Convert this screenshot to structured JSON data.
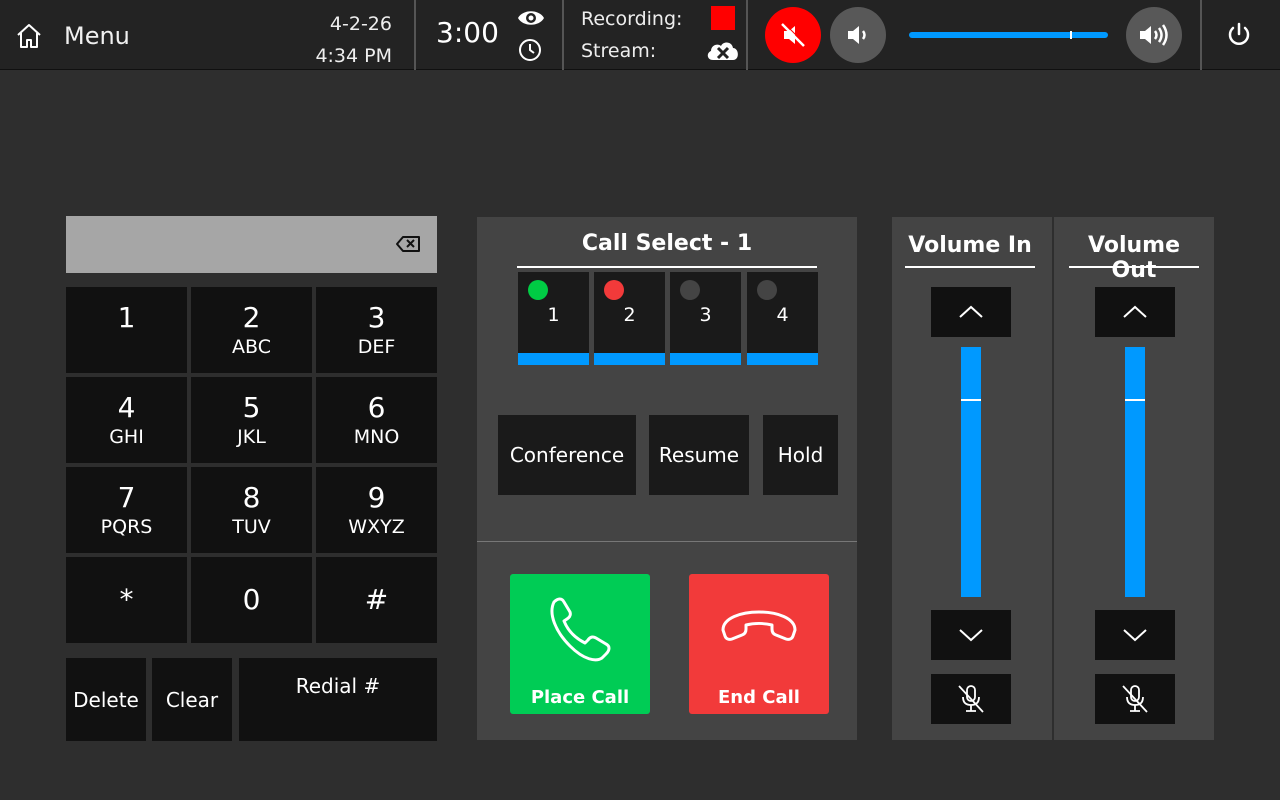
{
  "header": {
    "menu_label": "Menu",
    "date": "4-2-26",
    "time": "4:34 PM",
    "timer": "3:00",
    "recording_label": "Recording:",
    "stream_label": "Stream:",
    "recording_status_color": "#ff0000",
    "master_volume_fraction": 0.81,
    "icons": [
      "home-icon",
      "eye-icon",
      "clock-icon",
      "cloud-off-icon",
      "speaker-mute-icon",
      "volume-down-icon",
      "volume-up-icon",
      "power-icon"
    ]
  },
  "keypad": {
    "dial_value": "",
    "keys": [
      {
        "num": "1",
        "letters": ""
      },
      {
        "num": "2",
        "letters": "ABC"
      },
      {
        "num": "3",
        "letters": "DEF"
      },
      {
        "num": "4",
        "letters": "GHI"
      },
      {
        "num": "5",
        "letters": "JKL"
      },
      {
        "num": "6",
        "letters": "MNO"
      },
      {
        "num": "7",
        "letters": "PQRS"
      },
      {
        "num": "8",
        "letters": "TUV"
      },
      {
        "num": "9",
        "letters": "WXYZ"
      },
      {
        "num": "*",
        "letters": ""
      },
      {
        "num": "0",
        "letters": ""
      },
      {
        "num": "#",
        "letters": ""
      }
    ],
    "delete_label": "Delete",
    "clear_label": "Clear",
    "redial_label": "Redial #"
  },
  "call_select": {
    "title": "Call Select - 1",
    "lines": [
      {
        "num": "1",
        "status_color": "#00cc44"
      },
      {
        "num": "2",
        "status_color": "#f23a3a"
      },
      {
        "num": "3",
        "status_color": "#444444"
      },
      {
        "num": "4",
        "status_color": "#444444"
      }
    ],
    "conference_label": "Conference",
    "resume_label": "Resume",
    "hold_label": "Hold",
    "place_call_label": "Place Call",
    "end_call_label": "End Call"
  },
  "volume": {
    "in_title": "Volume In",
    "out_title": "Volume Out",
    "in_level": 0.79,
    "out_level": 0.79,
    "accent": "#0099ff"
  }
}
